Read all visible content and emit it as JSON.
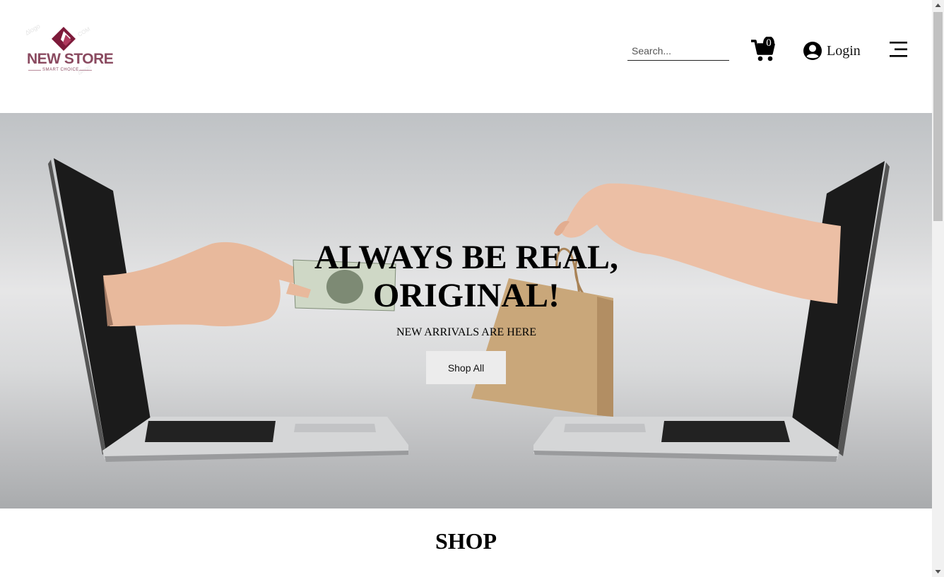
{
  "header": {
    "logo": {
      "name": "NEW STORE",
      "tagline": "SMART CHOICE",
      "color": "#7d1a3a"
    },
    "search": {
      "placeholder": "Search...",
      "value": ""
    },
    "cart": {
      "icon": "shopping-cart-icon",
      "count": "0"
    },
    "login": {
      "icon": "user-circle-icon",
      "label": "Login"
    },
    "menu": {
      "icon": "hamburger-menu-icon"
    }
  },
  "hero": {
    "title": "ALWAYS BE REAL, ORIGINAL!",
    "subtitle": "NEW ARRIVALS ARE HERE",
    "button_label": "Shop All"
  },
  "shop": {
    "heading": "SHOP"
  },
  "colors": {
    "accent": "#7d1a3a",
    "hero_button_bg": "#ececec"
  }
}
